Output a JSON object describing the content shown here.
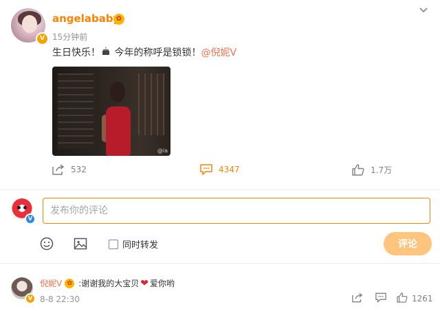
{
  "post": {
    "username": "angelababy",
    "timestamp": "15分钟前",
    "text_before": "生日快乐！",
    "text_after": " 今年的称呼是锁锁！",
    "mention": "@倪妮V",
    "image_watermark": "@ia",
    "actions": {
      "repost_count": "532",
      "comment_count": "4347",
      "like_count": "1.7万"
    }
  },
  "composer": {
    "placeholder": "发布你的评论",
    "also_repost_label": "同时转发",
    "submit_label": "评论"
  },
  "comment": {
    "username": "倪妮V",
    "text_before": ":谢谢我的大宝贝",
    "text_after": "爱你哟",
    "time": "8-8 22:30",
    "like_count": "1261"
  },
  "colors": {
    "accent": "#ff8200",
    "mention": "#eb7350",
    "submit_disabled": "#ffc47d"
  },
  "icons": [
    "chevron-down-icon",
    "repost-icon",
    "comment-icon",
    "like-icon",
    "emoji-icon",
    "image-icon",
    "verified-badge-icon",
    "cake-icon",
    "heart-icon"
  ]
}
